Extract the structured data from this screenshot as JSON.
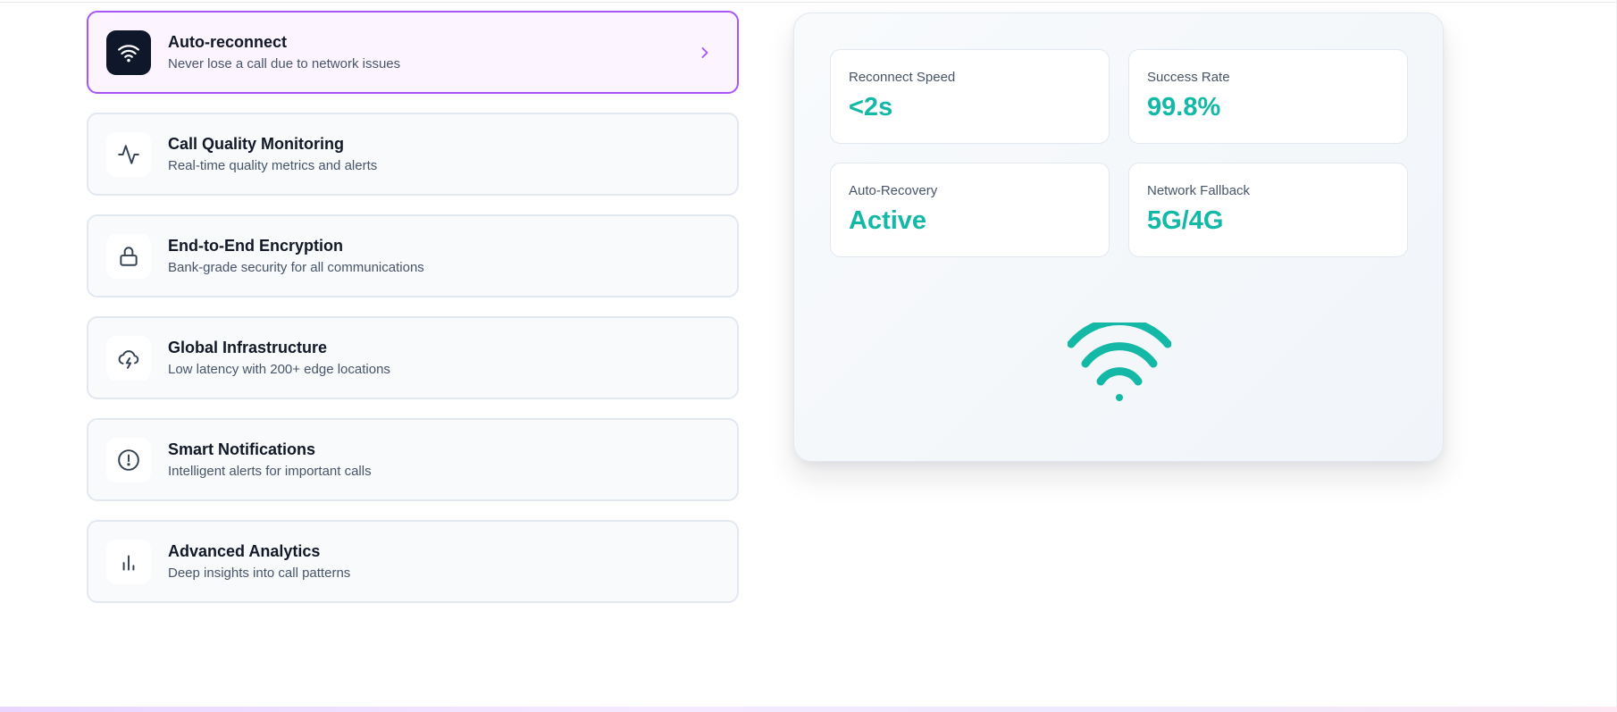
{
  "features": [
    {
      "title": "Auto-reconnect",
      "desc": "Never lose a call due to network issues",
      "icon": "wifi-icon",
      "active": true
    },
    {
      "title": "Call Quality Monitoring",
      "desc": "Real-time quality metrics and alerts",
      "icon": "activity-icon"
    },
    {
      "title": "End-to-End Encryption",
      "desc": "Bank-grade security for all communications",
      "icon": "lock-icon"
    },
    {
      "title": "Global Infrastructure",
      "desc": "Low latency with 200+ edge locations",
      "icon": "cloud-lightning-icon"
    },
    {
      "title": "Smart Notifications",
      "desc": "Intelligent alerts for important calls",
      "icon": "alert-circle-icon"
    },
    {
      "title": "Advanced Analytics",
      "desc": "Deep insights into call patterns",
      "icon": "bar-chart-icon"
    }
  ],
  "stats": [
    {
      "label": "Reconnect Speed",
      "value": "<2s"
    },
    {
      "label": "Success Rate",
      "value": "99.8%"
    },
    {
      "label": "Auto-Recovery",
      "value": "Active"
    },
    {
      "label": "Network Fallback",
      "value": "5G/4G"
    }
  ],
  "colors": {
    "accent_teal": "#14b8a6",
    "active_border": "#a855f7",
    "active_bg": "#fcf4ff",
    "icon_dark": "#0f172a"
  },
  "panel": {
    "icon": "wifi-icon"
  }
}
